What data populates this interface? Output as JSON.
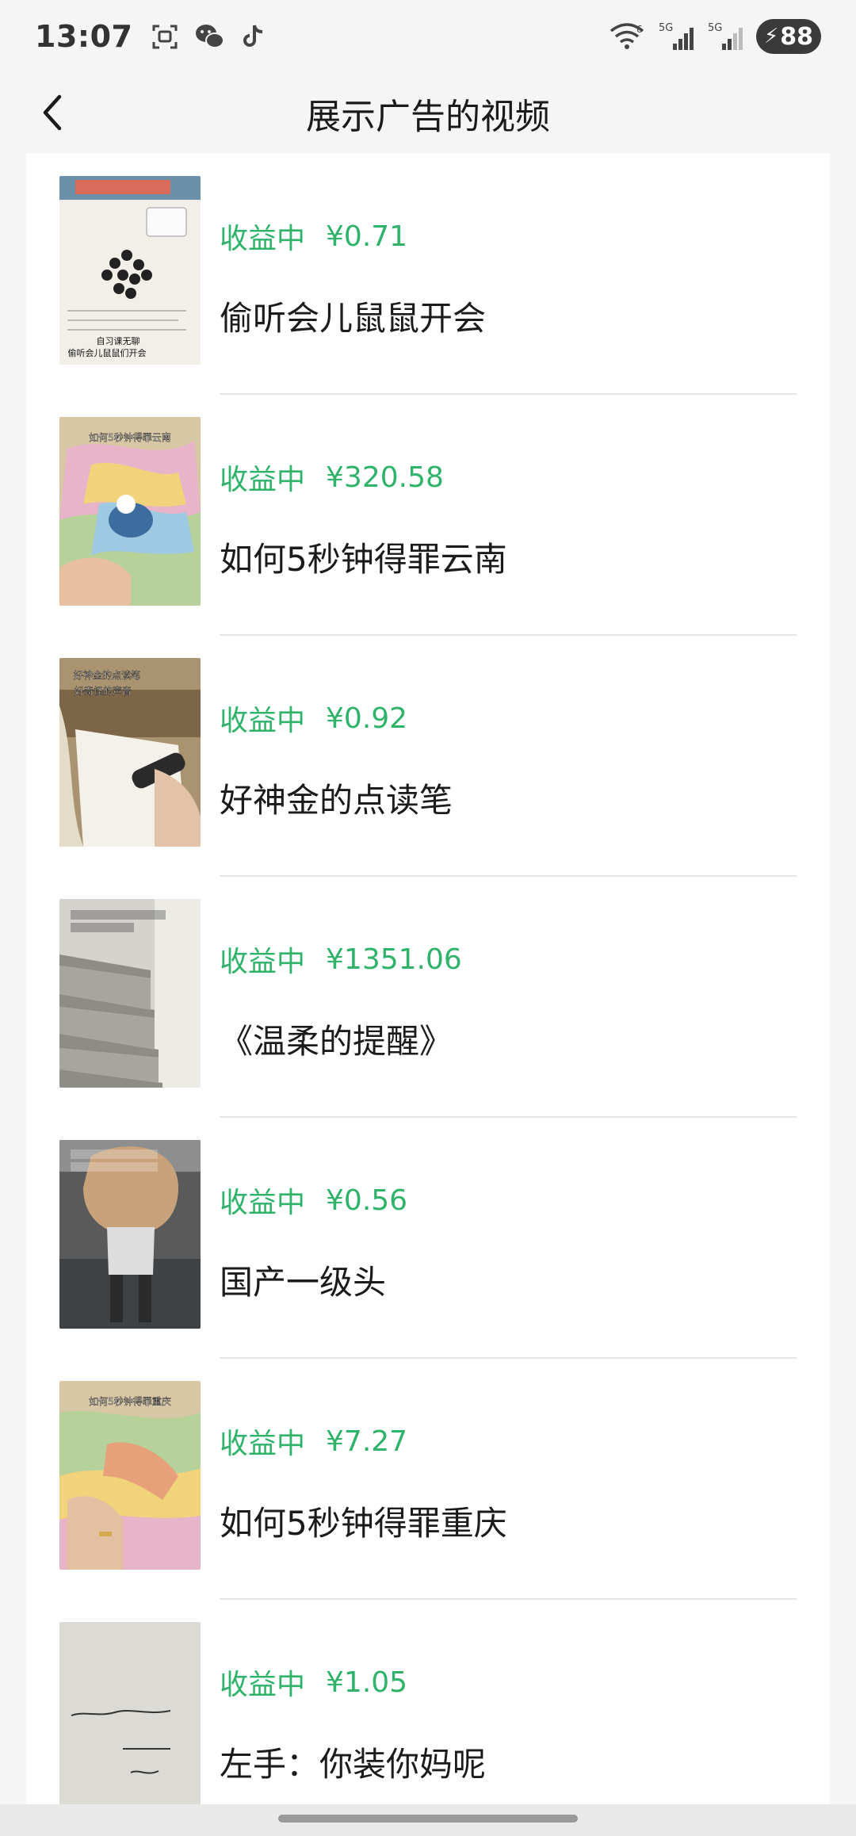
{
  "status_bar": {
    "time": "13:07",
    "left_icons": [
      "screenshot-icon",
      "wechat-icon",
      "tiktok-icon"
    ],
    "right_icons": [
      "wifi-icon",
      "signal-5g-icon",
      "signal-5g-icon"
    ],
    "wifi_badge": "6",
    "signal_label": "5G",
    "signal_label_2": "5G",
    "battery_level": "88"
  },
  "header": {
    "title": "展示广告的视频",
    "back_icon": "chevron-left-icon"
  },
  "colors": {
    "accent_green": "#2fb36a",
    "background": "#f5f5f5",
    "card": "#ffffff"
  },
  "videos": [
    {
      "status": "收益中",
      "amount": "¥0.71",
      "title": "偷听会儿鼠鼠开会",
      "thumb_caption": "自习课无聊 偷听会儿鼠鼠们开会"
    },
    {
      "status": "收益中",
      "amount": "¥320.58",
      "title": "如何5秒钟得罪云南",
      "thumb_caption": "如何5秒钟得罪云南"
    },
    {
      "status": "收益中",
      "amount": "¥0.92",
      "title": "好神金的点读笔",
      "thumb_caption": "好神金的点读笔 好奇怪的声音"
    },
    {
      "status": "收益中",
      "amount": "¥1351.06",
      "title": "《温柔的提醒》",
      "thumb_caption": ""
    },
    {
      "status": "收益中",
      "amount": "¥0.56",
      "title": "国产一级头",
      "thumb_caption": ""
    },
    {
      "status": "收益中",
      "amount": "¥7.27",
      "title": "如何5秒钟得罪重庆",
      "thumb_caption": "如何5秒钟得罪重庆"
    },
    {
      "status": "收益中",
      "amount": "¥1.05",
      "title": "左手：你装你妈呢",
      "thumb_caption": ""
    }
  ]
}
